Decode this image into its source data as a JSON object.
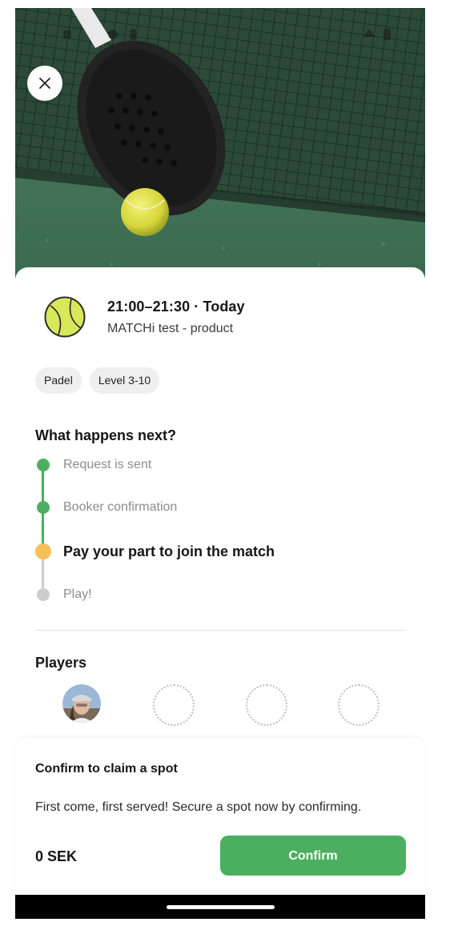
{
  "header": {
    "close_icon": "close-icon"
  },
  "match": {
    "time": "21:00–21:30 · Today",
    "venue": "MATCHi test - product",
    "sport_icon": "tennis-ball-icon",
    "tags": [
      "Padel",
      "Level 3-10"
    ]
  },
  "next_steps": {
    "title": "What happens next?",
    "steps": [
      {
        "label": "Request is sent",
        "state": "done"
      },
      {
        "label": "Booker confirmation",
        "state": "done"
      },
      {
        "label": "Pay your part to join the match",
        "state": "current"
      },
      {
        "label": "Play!",
        "state": "pending"
      }
    ]
  },
  "players": {
    "title": "Players",
    "total_slots": 4,
    "filled_slots": 1
  },
  "confirm": {
    "title": "Confirm to claim a spot",
    "description": "First come, first served! Secure a spot now by confirming.",
    "price": "0 SEK",
    "button_label": "Confirm"
  },
  "colors": {
    "done": "#4caf5f",
    "current": "#f5c05a",
    "pending": "#cccccc",
    "accent": "#4caf5f"
  }
}
